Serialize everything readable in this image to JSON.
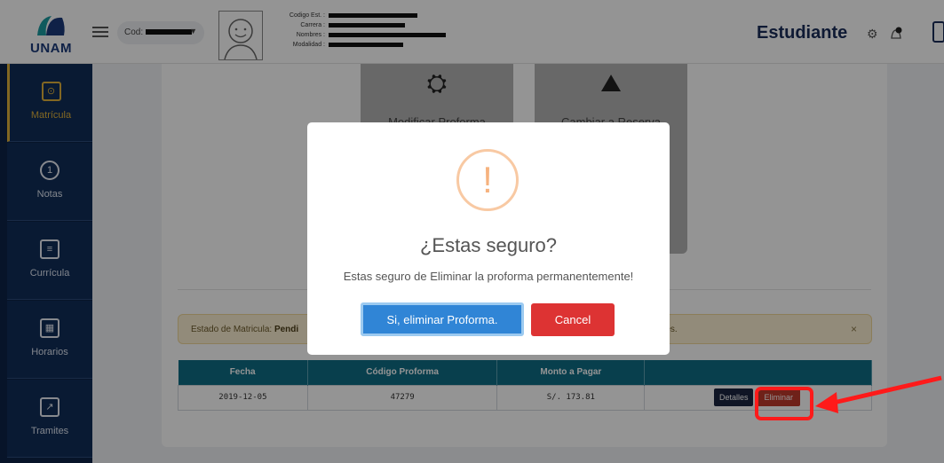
{
  "header": {
    "logo_text": "UNAM",
    "cod_label": "Cod:",
    "info_labels": [
      "Codigo Est. :",
      "Carrera :",
      "Nombres :",
      "Modalidad :"
    ],
    "role": "Estudiante"
  },
  "sidebar": {
    "items": [
      {
        "label": "Matrícula",
        "icon": "register-icon",
        "glyph": "⊙"
      },
      {
        "label": "Notas",
        "icon": "medal-icon",
        "glyph": "1"
      },
      {
        "label": "Currícula",
        "icon": "document-icon",
        "glyph": "≡"
      },
      {
        "label": "Horarios",
        "icon": "calendar-icon",
        "glyph": "▦"
      },
      {
        "label": "Tramites",
        "icon": "share-icon",
        "glyph": "↗"
      }
    ]
  },
  "tiles": {
    "modify": {
      "label": "Modificar Proforma",
      "glyph": "⛭"
    },
    "change": {
      "label": "Cambiar a Reserva",
      "glyph": "⛰"
    }
  },
  "alert": {
    "label": "Estado de Matricula:",
    "value": "Pendi",
    "tail": "ntes.",
    "close": "×"
  },
  "table": {
    "headers": [
      "Fecha",
      "Código Proforma",
      "Monto a Pagar",
      ""
    ],
    "rows": [
      {
        "fecha": "2019-12-05",
        "codigo": "47279",
        "monto": "S/. 173.81",
        "details": "Detalles",
        "delete": "Eliminar"
      }
    ]
  },
  "modal": {
    "icon_glyph": "!",
    "title": "¿Estas seguro?",
    "text": "Estas seguro de Eliminar la proforma permanentemente!",
    "confirm_label": "Si, eliminar Proforma.",
    "cancel_label": "Cancel"
  },
  "colors": {
    "sidebar": "#0d2447",
    "accent": "#e0b23c",
    "confirm": "#3085d6",
    "cancel": "#dd3333",
    "table_header": "#0e6d86",
    "annotation": "#ff1a1a"
  }
}
